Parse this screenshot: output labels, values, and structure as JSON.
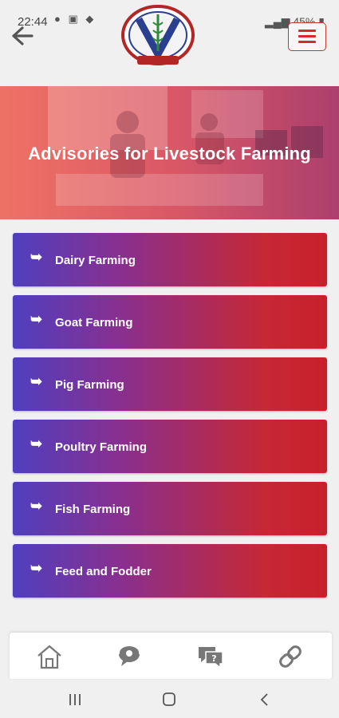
{
  "status_bar": {
    "time": "22:44",
    "battery": "45%"
  },
  "header": {
    "logo_icon": "university-crest-logo",
    "back_icon": "arrow-left-icon",
    "menu_icon": "hamburger-menu-icon"
  },
  "hero": {
    "title": "Advisories for Livestock Farming"
  },
  "advisories": [
    {
      "label": "Dairy Farming"
    },
    {
      "label": "Goat Farming"
    },
    {
      "label": "Pig Farming"
    },
    {
      "label": "Poultry Farming"
    },
    {
      "label": "Fish Farming"
    },
    {
      "label": "Feed and Fodder"
    }
  ],
  "bottom_nav": [
    "home-icon",
    "support-chat-icon",
    "faq-icon",
    "link-icon"
  ],
  "colors": {
    "accent_red": "#c8202a",
    "accent_blue": "#4f3fbf"
  }
}
